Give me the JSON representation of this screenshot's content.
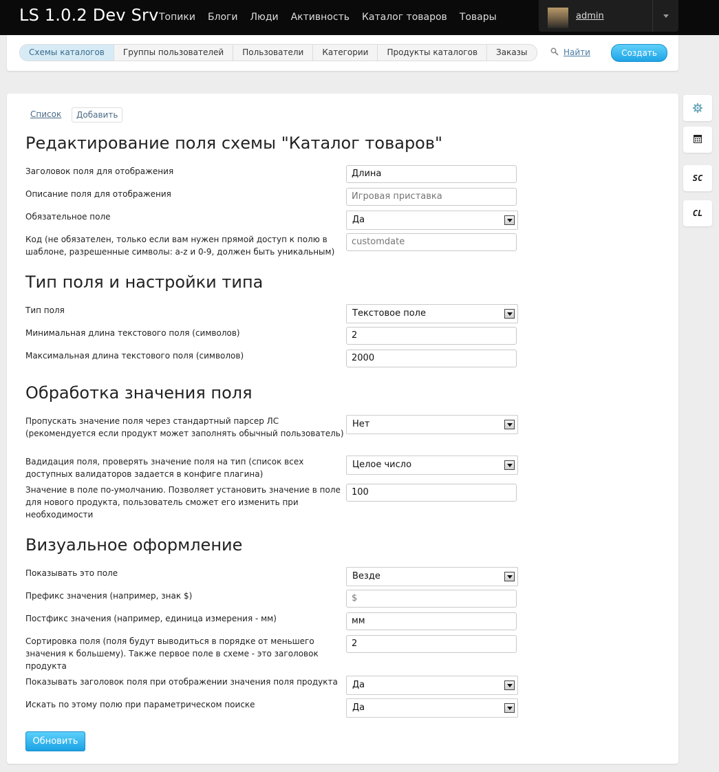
{
  "app": {
    "title": "LS 1.0.2 Dev Srv"
  },
  "nav": [
    "Топики",
    "Блоги",
    "Люди",
    "Активность",
    "Каталог товаров",
    "Товары"
  ],
  "user": {
    "name": "admin"
  },
  "subnav": {
    "tabs": [
      "Схемы каталогов",
      "Группы пользователей",
      "Пользователи",
      "Категории",
      "Продукты каталогов",
      "Заказы"
    ],
    "active_tab": "Схемы каталогов",
    "search_label": "Найти",
    "create_label": "Создать"
  },
  "actions": {
    "list_label": "Список",
    "add_label": "Добавить"
  },
  "page": {
    "title": "Редактирование поля схемы \"Каталог товаров\""
  },
  "sections": [
    {
      "heading": "",
      "fields": [
        {
          "label": "Заголовок поля для отображения",
          "type": "input",
          "value": "Длина"
        },
        {
          "label": "Описание поля для отображения",
          "type": "input",
          "value": "",
          "placeholder": "Игровая приставка"
        },
        {
          "label": "Обязательное поле",
          "type": "select",
          "value": "Да"
        },
        {
          "label": "Код (не обязателен, только если вам нужен прямой доступ к полю в шаблоне, разрешенные символы: a-z и 0-9, должен быть уникальным)",
          "type": "input",
          "value": "",
          "placeholder": "customdate"
        }
      ]
    },
    {
      "heading": "Тип поля и настройки типа",
      "fields": [
        {
          "label": "Тип поля",
          "type": "select",
          "value": "Текстовое поле"
        },
        {
          "label": "Минимальная длина текстового поля (символов)",
          "type": "input",
          "value": "2"
        },
        {
          "label": "Максимальная длина текстового поля (символов)",
          "type": "input",
          "value": "2000"
        }
      ]
    },
    {
      "heading": "Обработка значения поля",
      "fields": [
        {
          "label": "Пропускать значение поля через стандартный парсер ЛС (рекомендуется если продукт может заполнять обычный пользователь)",
          "type": "select",
          "value": "Нет"
        },
        {
          "label": "Вадидация поля, проверять значение поля на тип (список всех доступных валидаторов задается в конфиге плагина)",
          "type": "select",
          "value": "Целое число"
        },
        {
          "label": "Значение в поле по-умолчанию. Позволяет установить значение в поле для нового продукта, пользователь сможет его изменить при необходимости",
          "type": "input",
          "value": "100"
        }
      ]
    },
    {
      "heading": "Визуальное оформление",
      "fields": [
        {
          "label": "Показывать это поле",
          "type": "select",
          "value": "Везде"
        },
        {
          "label": "Префикс значения (например, знак $)",
          "type": "input",
          "value": "",
          "placeholder": "$"
        },
        {
          "label": "Постфикс значения (например, единица измерения - мм)",
          "type": "input",
          "value": "мм"
        },
        {
          "label": "Сортировка поля (поля будут выводиться в порядке от меньшего значения к большему). Также первое поле в схеме - это заголовок продукта",
          "type": "input",
          "value": "2"
        },
        {
          "label": "Показывать заголовок поля при отображении значения поля продукта",
          "type": "select",
          "value": "Да"
        },
        {
          "label": "Искать по этому полю при параметрическом поиске",
          "type": "select",
          "value": "Да"
        }
      ]
    }
  ],
  "submit_label": "Обновить",
  "side_widgets": [
    {
      "icon": "gear-icon",
      "text": ""
    },
    {
      "icon": "calendar-icon",
      "text": ""
    },
    {
      "icon": "",
      "text": "SC"
    },
    {
      "icon": "",
      "text": "CL"
    }
  ]
}
